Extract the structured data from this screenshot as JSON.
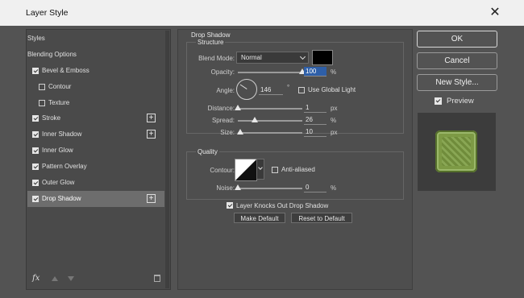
{
  "window": {
    "title": "Layer Style",
    "close_glyph": "✕"
  },
  "left_panel": {
    "items": [
      {
        "label": "Styles",
        "checkbox": null,
        "plus": false,
        "indent": false,
        "selected": false
      },
      {
        "label": "Blending Options",
        "checkbox": null,
        "plus": false,
        "indent": false,
        "selected": false
      },
      {
        "label": "Bevel & Emboss",
        "checkbox": true,
        "plus": false,
        "indent": false,
        "selected": false
      },
      {
        "label": "Contour",
        "checkbox": false,
        "plus": false,
        "indent": true,
        "selected": false
      },
      {
        "label": "Texture",
        "checkbox": false,
        "plus": false,
        "indent": true,
        "selected": false
      },
      {
        "label": "Stroke",
        "checkbox": true,
        "plus": true,
        "indent": false,
        "selected": false
      },
      {
        "label": "Inner Shadow",
        "checkbox": true,
        "plus": true,
        "indent": false,
        "selected": false
      },
      {
        "label": "Inner Glow",
        "checkbox": true,
        "plus": false,
        "indent": false,
        "selected": false
      },
      {
        "label": "Pattern Overlay",
        "checkbox": true,
        "plus": false,
        "indent": false,
        "selected": false
      },
      {
        "label": "Outer Glow",
        "checkbox": true,
        "plus": false,
        "indent": false,
        "selected": false
      },
      {
        "label": "Drop Shadow",
        "checkbox": true,
        "plus": true,
        "indent": false,
        "selected": true
      }
    ],
    "plus_glyph": "+",
    "fx_label": "fx"
  },
  "drop_shadow": {
    "section_title": "Drop Shadow",
    "structure_title": "Structure",
    "blend_mode_label": "Blend Mode:",
    "blend_mode_value": "Normal",
    "shadow_color": "#000000",
    "opacity_label": "Opacity:",
    "opacity_value": "100",
    "opacity_level": 1.0,
    "percent": "%",
    "angle_label": "Angle:",
    "angle_value": "146",
    "degree": "°",
    "use_global_light_label": "Use Global Light",
    "distance_label": "Distance:",
    "distance_value": "1",
    "distance_level": 0.0,
    "spread_label": "Spread:",
    "spread_value": "26",
    "spread_level": 0.26,
    "size_label": "Size:",
    "size_value": "10",
    "size_level": 0.04,
    "px": "px",
    "quality_title": "Quality",
    "contour_label": "Contour:",
    "anti_aliased_label": "Anti-aliased",
    "noise_label": "Noise:",
    "noise_value": "0",
    "noise_level": 0.0,
    "knocks_out_label": "Layer Knocks Out Drop Shadow",
    "make_default_label": "Make Default",
    "reset_default_label": "Reset to Default"
  },
  "right_panel": {
    "ok_label": "OK",
    "cancel_label": "Cancel",
    "new_style_label": "New Style...",
    "preview_label": "Preview"
  },
  "colors": {
    "dialog_bg": "#535353",
    "panel_bg": "#4a4a4a",
    "highlight": "#2e5fa8",
    "preview_green": "#7d9a45"
  }
}
